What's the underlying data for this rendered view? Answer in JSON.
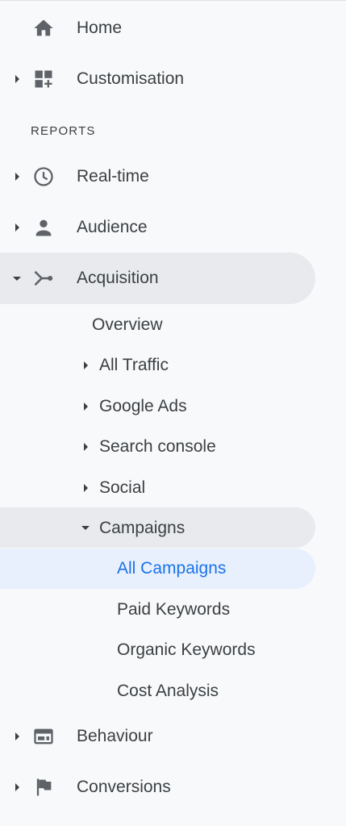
{
  "nav": {
    "home": {
      "label": "Home",
      "icon": "home-icon"
    },
    "customisation": {
      "label": "Customisation",
      "icon": "dashboard-add-icon"
    },
    "reports_header": "REPORTS",
    "realtime": {
      "label": "Real-time",
      "icon": "clock-icon"
    },
    "audience": {
      "label": "Audience",
      "icon": "person-icon"
    },
    "acquisition": {
      "label": "Acquisition",
      "icon": "acquisition-icon",
      "children": {
        "overview": "Overview",
        "all_traffic": "All Traffic",
        "google_ads": "Google Ads",
        "search_console": "Search console",
        "social": "Social",
        "campaigns": {
          "label": "Campaigns",
          "children": {
            "all_campaigns": "All Campaigns",
            "paid_keywords": "Paid Keywords",
            "organic_keywords": "Organic Keywords",
            "cost_analysis": "Cost Analysis"
          }
        }
      }
    },
    "behaviour": {
      "label": "Behaviour",
      "icon": "behaviour-icon"
    },
    "conversions": {
      "label": "Conversions",
      "icon": "flag-icon"
    }
  },
  "colors": {
    "text": "#3c4043",
    "active_text": "#1a73e8",
    "active_bg": "#e8f0fe",
    "expanded_bg": "#e8eaed",
    "background": "#f8f9fa",
    "icon": "#5f6368"
  }
}
